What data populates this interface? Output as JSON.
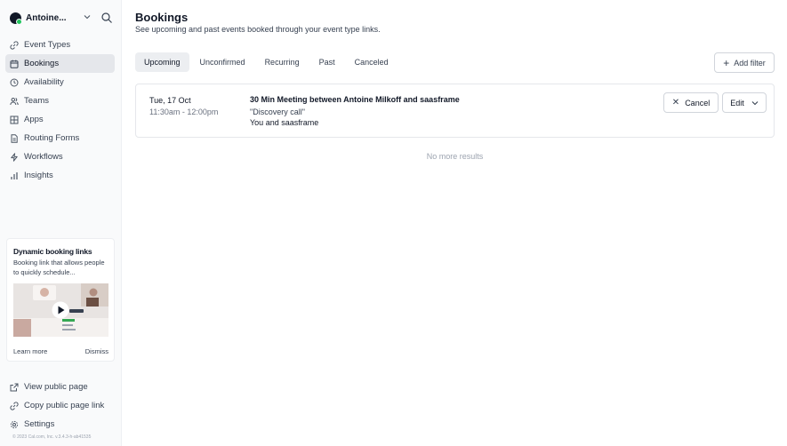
{
  "user": {
    "name": "Antoine..."
  },
  "nav": [
    {
      "label": "Event Types",
      "icon": "link-icon",
      "active": false
    },
    {
      "label": "Bookings",
      "icon": "calendar-icon",
      "active": true
    },
    {
      "label": "Availability",
      "icon": "clock-icon",
      "active": false
    },
    {
      "label": "Teams",
      "icon": "users-icon",
      "active": false
    },
    {
      "label": "Apps",
      "icon": "grid-icon",
      "active": false
    },
    {
      "label": "Routing Forms",
      "icon": "file-text-icon",
      "active": false
    },
    {
      "label": "Workflows",
      "icon": "zap-icon",
      "active": false
    },
    {
      "label": "Insights",
      "icon": "bar-chart-icon",
      "active": false
    }
  ],
  "promo": {
    "title": "Dynamic booking links",
    "description": "Booking link that allows people to quickly schedule...",
    "learn_more": "Learn more",
    "dismiss": "Dismiss"
  },
  "bottom_nav": [
    {
      "label": "View public page",
      "icon": "external-link-icon"
    },
    {
      "label": "Copy public page link",
      "icon": "copy-icon"
    },
    {
      "label": "Settings",
      "icon": "gear-icon"
    }
  ],
  "copyright": "© 2023 Cal.com, Inc. v.3.4.3-h-ab41535",
  "page": {
    "title": "Bookings",
    "subtitle": "See upcoming and past events booked through your event type links."
  },
  "tabs": [
    {
      "label": "Upcoming",
      "active": true
    },
    {
      "label": "Unconfirmed",
      "active": false
    },
    {
      "label": "Recurring",
      "active": false
    },
    {
      "label": "Past",
      "active": false
    },
    {
      "label": "Canceled",
      "active": false
    }
  ],
  "add_filter": "Add filter",
  "booking": {
    "date": "Tue, 17 Oct",
    "time": "11:30am - 12:00pm",
    "title": "30 Min Meeting between Antoine Milkoff and saasframe",
    "description": "\"Discovery call\"",
    "attendees": "You and saasframe",
    "cancel_label": "Cancel",
    "edit_label": "Edit"
  },
  "no_more_results": "No more results",
  "colors": {
    "active_bg": "#e5e7eb",
    "sidebar_bg": "#f9fafb",
    "status_online": "#22c55e"
  }
}
